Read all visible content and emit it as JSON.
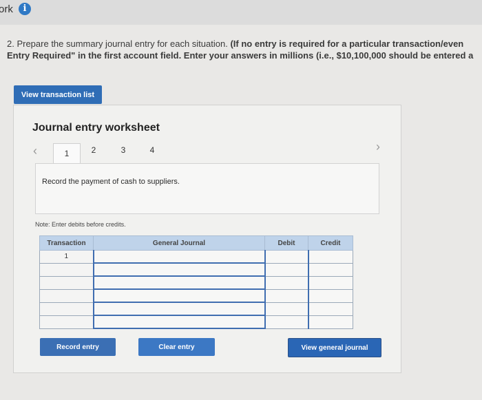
{
  "header": {
    "label": "ork"
  },
  "instructions": {
    "line1_plain": "2. Prepare the summary journal entry for each situation. ",
    "line1_bold": "(If no entry is required for a particular transaction/even",
    "line2": "Entry Required\" in the first account field. Enter your answers in millions (i.e., $10,100,000 should be entered a"
  },
  "buttons": {
    "view_transaction_list": "View transaction list",
    "record_entry": "Record entry",
    "clear_entry": "Clear entry",
    "view_general_journal": "View general journal"
  },
  "worksheet": {
    "title": "Journal entry worksheet",
    "tabs": [
      "1",
      "2",
      "3",
      "4"
    ],
    "active_tab": "1",
    "description": "Record the payment of cash to suppliers.",
    "note": "Note: Enter debits before credits."
  },
  "journal": {
    "headers": [
      "Transaction",
      "General Journal",
      "Debit",
      "Credit"
    ],
    "rows": [
      [
        "1",
        "",
        "",
        ""
      ],
      [
        "",
        "",
        "",
        ""
      ],
      [
        "",
        "",
        "",
        ""
      ],
      [
        "",
        "",
        "",
        ""
      ],
      [
        "",
        "",
        "",
        ""
      ],
      [
        "",
        "",
        "",
        ""
      ]
    ]
  },
  "colors": {
    "primary_button": "#2f6db6",
    "table_header": "#bfd3ea",
    "info_icon": "#2f79c5"
  },
  "icons": [
    "info-icon",
    "chevron-left-icon",
    "chevron-right-icon"
  ]
}
